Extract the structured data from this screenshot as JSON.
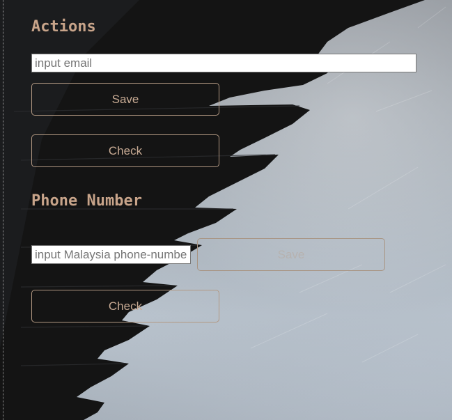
{
  "actions": {
    "title": "Actions",
    "email_input": {
      "placeholder": "input email",
      "value": ""
    },
    "save_label": "Save",
    "check_label": "Check"
  },
  "phone": {
    "title": "Phone Number",
    "phone_input": {
      "placeholder": "input Malaysia phone-number",
      "value": ""
    },
    "save_label": "Save",
    "check_label": "Check"
  },
  "colors": {
    "accent_text": "#c8a48a",
    "button_border": "#b29882",
    "wing": "#141414"
  }
}
